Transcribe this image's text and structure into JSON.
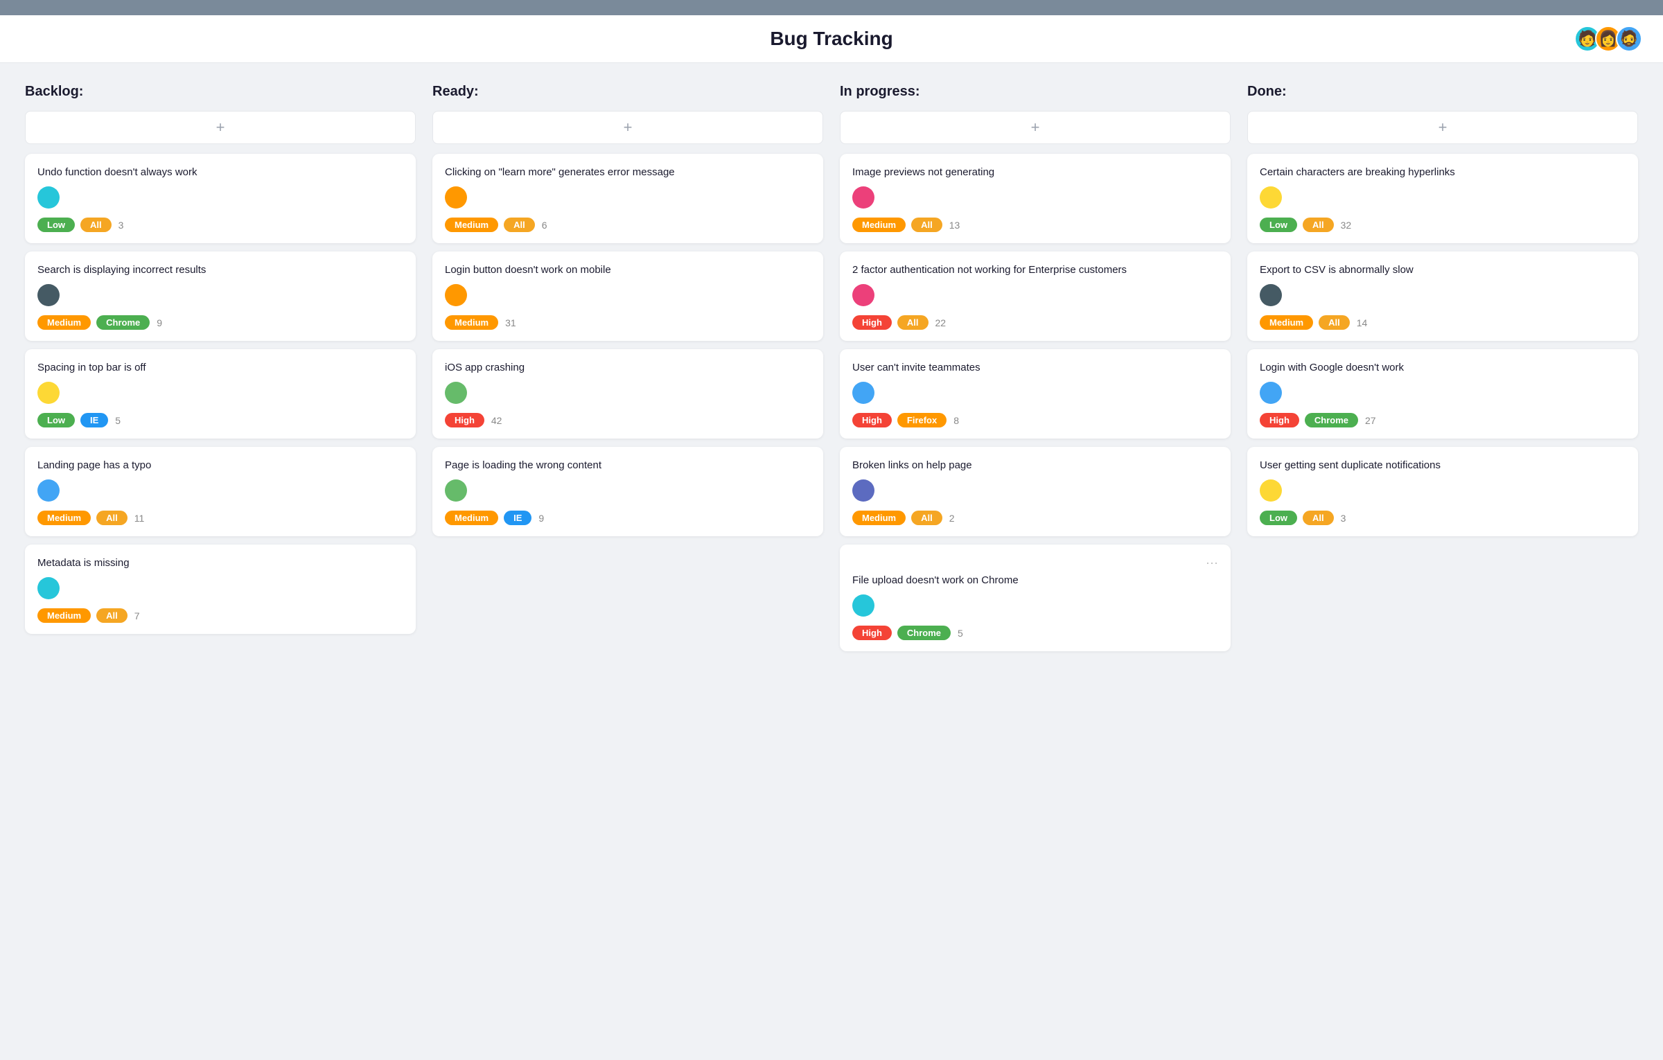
{
  "header": {
    "title": "Bug Tracking"
  },
  "columns": [
    {
      "id": "backlog",
      "label": "Backlog:",
      "cards": [
        {
          "id": "c1",
          "title": "Undo function doesn't always work",
          "avatar_color": "avatar-teal",
          "avatar_emoji": "🙂",
          "priority": "Low",
          "priority_class": "badge-low",
          "platform": "All",
          "platform_class": "badge-all",
          "count": "3"
        },
        {
          "id": "c2",
          "title": "Search is displaying incorrect results",
          "avatar_color": "avatar-dark",
          "avatar_emoji": "😐",
          "priority": "Medium",
          "priority_class": "badge-medium",
          "platform": "Chrome",
          "platform_class": "badge-chrome",
          "count": "9"
        },
        {
          "id": "c3",
          "title": "Spacing in top bar is off",
          "avatar_color": "avatar-yellow",
          "avatar_emoji": "😊",
          "priority": "Low",
          "priority_class": "badge-low",
          "platform": "IE",
          "platform_class": "badge-ie",
          "count": "5"
        },
        {
          "id": "c4",
          "title": "Landing page has a typo",
          "avatar_color": "avatar-blue",
          "avatar_emoji": "🙂",
          "priority": "Medium",
          "priority_class": "badge-medium",
          "platform": "All",
          "platform_class": "badge-all",
          "count": "11"
        },
        {
          "id": "c5",
          "title": "Metadata is missing",
          "avatar_color": "avatar-teal",
          "avatar_emoji": "🙂",
          "priority": "Medium",
          "priority_class": "badge-medium",
          "platform": "All",
          "platform_class": "badge-all",
          "count": "7"
        }
      ]
    },
    {
      "id": "ready",
      "label": "Ready:",
      "cards": [
        {
          "id": "r1",
          "title": "Clicking on \"learn more\" generates error message",
          "avatar_color": "avatar-orange",
          "avatar_emoji": "😏",
          "priority": "Medium",
          "priority_class": "badge-medium",
          "platform": "All",
          "platform_class": "badge-all",
          "count": "6"
        },
        {
          "id": "r2",
          "title": "Login button doesn't work on mobile",
          "avatar_color": "avatar-orange",
          "avatar_emoji": "😏",
          "priority": "Medium",
          "priority_class": "badge-medium",
          "platform": null,
          "count": "31"
        },
        {
          "id": "r3",
          "title": "iOS app crashing",
          "avatar_color": "avatar-green",
          "avatar_emoji": "😊",
          "priority": "High",
          "priority_class": "badge-high",
          "platform": null,
          "count": "42"
        },
        {
          "id": "r4",
          "title": "Page is loading the wrong content",
          "avatar_color": "avatar-green",
          "avatar_emoji": "😊",
          "priority": "Medium",
          "priority_class": "badge-medium",
          "platform": "IE",
          "platform_class": "badge-ie",
          "count": "9"
        }
      ]
    },
    {
      "id": "inprogress",
      "label": "In progress:",
      "cards": [
        {
          "id": "p1",
          "title": "Image previews not generating",
          "avatar_color": "avatar-pink",
          "avatar_emoji": "😮",
          "priority": "Medium",
          "priority_class": "badge-medium",
          "platform": "All",
          "platform_class": "badge-all",
          "count": "13"
        },
        {
          "id": "p2",
          "title": "2 factor authentication not working for Enterprise customers",
          "avatar_color": "avatar-pink",
          "avatar_emoji": "😮",
          "priority": "High",
          "priority_class": "badge-high",
          "platform": "All",
          "platform_class": "badge-all",
          "count": "22"
        },
        {
          "id": "p3",
          "title": "User can't invite teammates",
          "avatar_color": "avatar-blue",
          "avatar_emoji": "😐",
          "priority": "High",
          "priority_class": "badge-high",
          "platform": "Firefox",
          "platform_class": "badge-firefox",
          "count": "8"
        },
        {
          "id": "p4",
          "title": "Broken links on help page",
          "avatar_color": "avatar-indigo",
          "avatar_emoji": "😊",
          "priority": "Medium",
          "priority_class": "badge-medium",
          "platform": "All",
          "platform_class": "badge-all",
          "count": "2"
        },
        {
          "id": "p5",
          "title": "File upload doesn't work on Chrome",
          "avatar_color": "avatar-teal",
          "avatar_emoji": "🙂",
          "priority": "High",
          "priority_class": "badge-high",
          "platform": "Chrome",
          "platform_class": "badge-chrome",
          "count": "5",
          "has_dots": true
        }
      ]
    },
    {
      "id": "done",
      "label": "Done:",
      "cards": [
        {
          "id": "d1",
          "title": "Certain characters are breaking hyperlinks",
          "avatar_color": "avatar-yellow",
          "avatar_emoji": "😊",
          "priority": "Low",
          "priority_class": "badge-low",
          "platform": "All",
          "platform_class": "badge-all",
          "count": "32"
        },
        {
          "id": "d2",
          "title": "Export to CSV is abnormally slow",
          "avatar_color": "avatar-dark",
          "avatar_emoji": "😐",
          "priority": "Medium",
          "priority_class": "badge-medium",
          "platform": "All",
          "platform_class": "badge-all",
          "count": "14"
        },
        {
          "id": "d3",
          "title": "Login with Google doesn't work",
          "avatar_color": "avatar-blue",
          "avatar_emoji": "🙂",
          "priority": "High",
          "priority_class": "badge-high",
          "platform": "Chrome",
          "platform_class": "badge-chrome",
          "count": "27"
        },
        {
          "id": "d4",
          "title": "User getting sent duplicate notifications",
          "avatar_color": "avatar-yellow",
          "avatar_emoji": "😊",
          "priority": "Low",
          "priority_class": "badge-low",
          "platform": "All",
          "platform_class": "badge-all",
          "count": "3"
        }
      ]
    }
  ]
}
